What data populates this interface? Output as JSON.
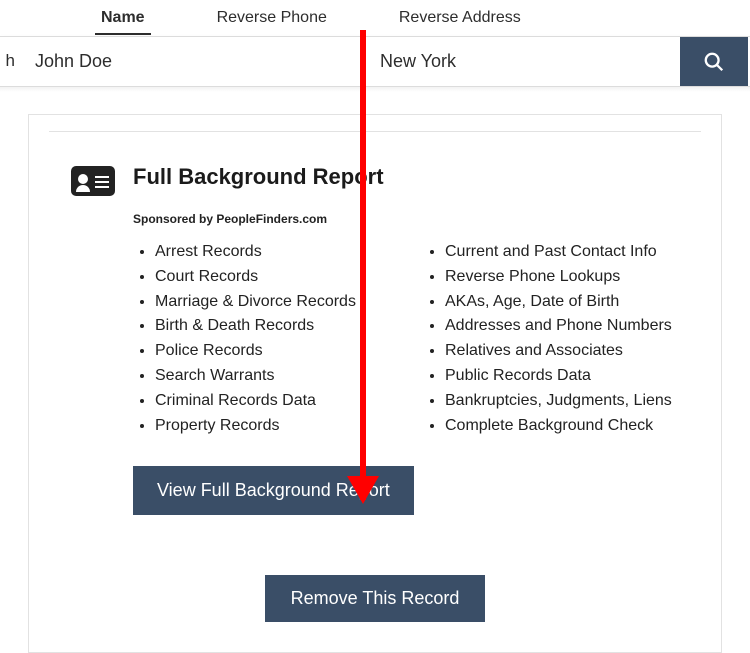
{
  "tabs": {
    "name": "Name",
    "reverse_phone": "Reverse Phone",
    "reverse_address": "Reverse Address"
  },
  "search": {
    "left_snippet": "h",
    "name_value": "John Doe",
    "location_value": "New York"
  },
  "report": {
    "title": "Full Background Report",
    "sponsored": "Sponsored by PeopleFinders.com",
    "left_items": [
      "Arrest Records",
      "Court Records",
      "Marriage & Divorce Records",
      "Birth & Death Records",
      "Police Records",
      "Search Warrants",
      "Criminal Records Data",
      "Property Records"
    ],
    "right_items": [
      "Current and Past Contact Info",
      "Reverse Phone Lookups",
      "AKAs, Age, Date of Birth",
      "Addresses and Phone Numbers",
      "Relatives and Associates",
      "Public Records Data",
      "Bankruptcies, Judgments, Liens",
      "Complete Background Check"
    ],
    "view_button": "View Full Background Report",
    "remove_button": "Remove This Record"
  }
}
